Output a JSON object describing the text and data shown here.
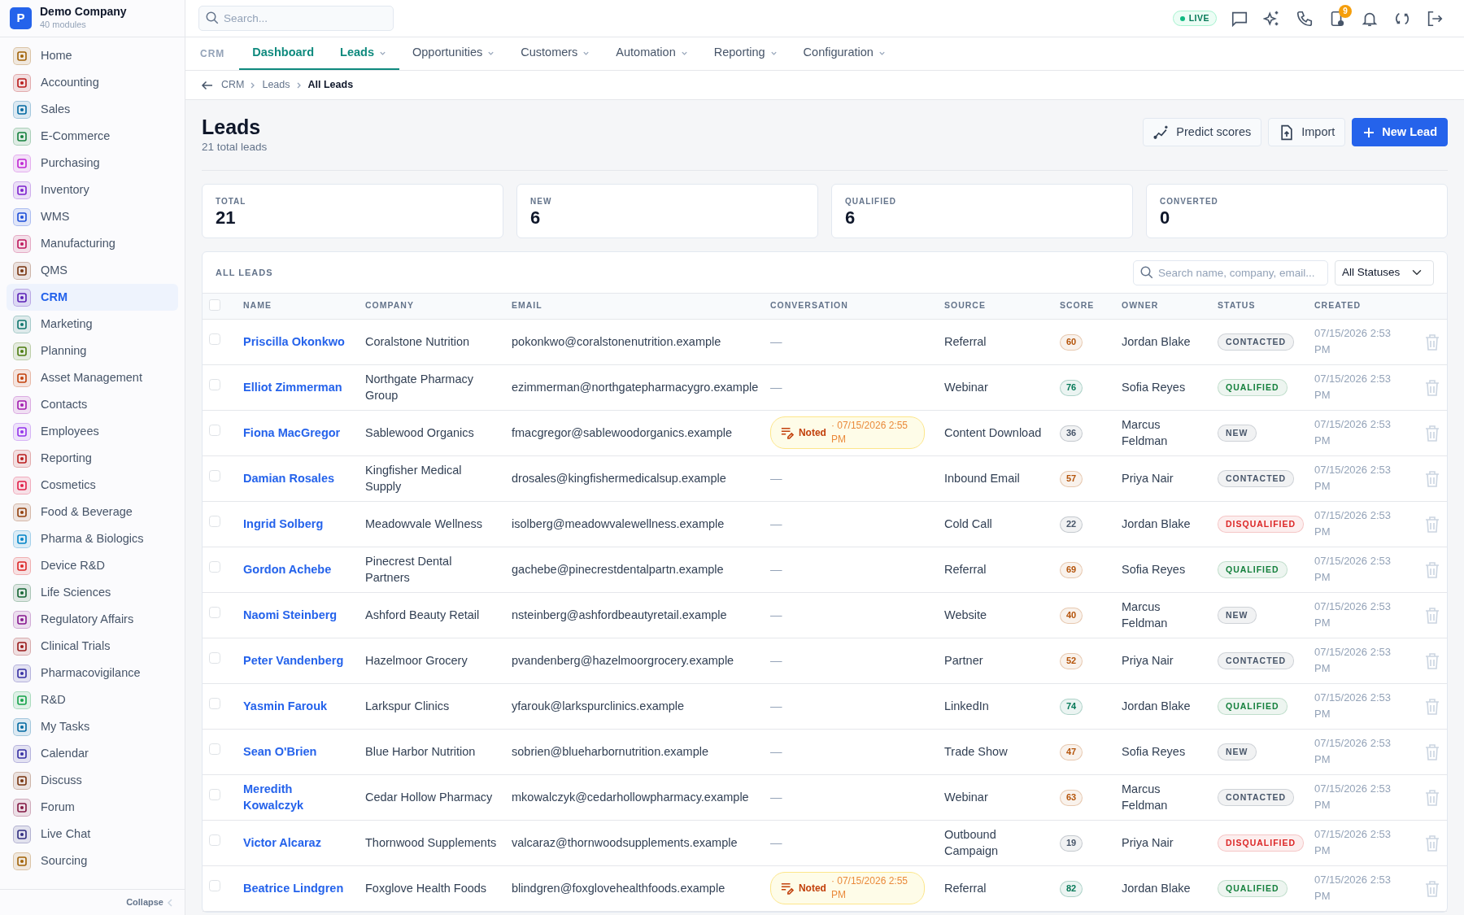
{
  "company": {
    "logo": "P",
    "name": "Demo Company",
    "subtitle": "40 modules"
  },
  "sidebar": {
    "items": [
      {
        "label": "Home",
        "color": "#a16207",
        "selected": false
      },
      {
        "label": "Accounting",
        "color": "#b91c1c",
        "selected": false
      },
      {
        "label": "Sales",
        "color": "#0369a1",
        "selected": false
      },
      {
        "label": "E-Commerce",
        "color": "#15803d",
        "selected": false
      },
      {
        "label": "Purchasing",
        "color": "#c026d3",
        "selected": false
      },
      {
        "label": "Inventory",
        "color": "#7e22ce",
        "selected": false
      },
      {
        "label": "WMS",
        "color": "#1d4ed8",
        "selected": false
      },
      {
        "label": "Manufacturing",
        "color": "#be185d",
        "selected": false
      },
      {
        "label": "QMS",
        "color": "#78350f",
        "selected": false
      },
      {
        "label": "CRM",
        "color": "#5b21b6",
        "selected": true
      },
      {
        "label": "Marketing",
        "color": "#0f766e",
        "selected": false
      },
      {
        "label": "Planning",
        "color": "#4d7c0f",
        "selected": false
      },
      {
        "label": "Asset Management",
        "color": "#c2410c",
        "selected": false
      },
      {
        "label": "Contacts",
        "color": "#a21caf",
        "selected": false
      },
      {
        "label": "Employees",
        "color": "#9333ea",
        "selected": false
      },
      {
        "label": "Reporting",
        "color": "#b91c1c",
        "selected": false
      },
      {
        "label": "Cosmetics",
        "color": "#e11d48",
        "selected": false
      },
      {
        "label": "Food & Beverage",
        "color": "#92400e",
        "selected": false
      },
      {
        "label": "Pharma & Biologics",
        "color": "#0284c7",
        "selected": false
      },
      {
        "label": "Device R&D",
        "color": "#dc2626",
        "selected": false
      },
      {
        "label": "Life Sciences",
        "color": "#166534",
        "selected": false
      },
      {
        "label": "Regulatory Affairs",
        "color": "#86198f",
        "selected": false
      },
      {
        "label": "Clinical Trials",
        "color": "#991b1b",
        "selected": false
      },
      {
        "label": "Pharmacovigilance",
        "color": "#3730a3",
        "selected": false
      },
      {
        "label": "R&D",
        "color": "#16a34a",
        "selected": false
      },
      {
        "label": "My Tasks",
        "color": "#0369a1",
        "selected": false
      },
      {
        "label": "Calendar",
        "color": "#3730a3",
        "selected": false
      },
      {
        "label": "Discuss",
        "color": "#78350f",
        "selected": false
      },
      {
        "label": "Forum",
        "color": "#831843",
        "selected": false
      },
      {
        "label": "Live Chat",
        "color": "#312e81",
        "selected": false
      },
      {
        "label": "Sourcing",
        "color": "#a16207",
        "selected": false
      }
    ],
    "collapse": "Collapse"
  },
  "topbar": {
    "search": {
      "placeholder": "Search..."
    },
    "live": "LIVE",
    "notification_count": "9"
  },
  "nav": {
    "section": "CRM",
    "tabs": [
      {
        "label": "Dashboard",
        "selected": true,
        "dropdown": false
      },
      {
        "label": "Leads",
        "selected": true,
        "dropdown": true
      },
      {
        "label": "Opportunities",
        "selected": false,
        "dropdown": true
      },
      {
        "label": "Customers",
        "selected": false,
        "dropdown": true
      },
      {
        "label": "Automation",
        "selected": false,
        "dropdown": true
      },
      {
        "label": "Reporting",
        "selected": false,
        "dropdown": true
      },
      {
        "label": "Configuration",
        "selected": false,
        "dropdown": true
      }
    ]
  },
  "breadcrumb": [
    "CRM",
    "Leads",
    "All Leads"
  ],
  "header": {
    "title": "Leads",
    "subtitle": "21 total leads",
    "buttons": [
      {
        "label": "Predict scores",
        "kind": "predict"
      },
      {
        "label": "Import",
        "kind": "import"
      },
      {
        "label": "New Lead",
        "kind": "new"
      }
    ]
  },
  "stats": [
    {
      "label": "TOTAL",
      "value": "21"
    },
    {
      "label": "NEW",
      "value": "6"
    },
    {
      "label": "QUALIFIED",
      "value": "6"
    },
    {
      "label": "CONVERTED",
      "value": "0"
    }
  ],
  "table": {
    "title": "ALL LEADS",
    "search": {
      "placeholder": "Search name, company, email..."
    },
    "status_filter": "All Statuses",
    "select_all_checked": false,
    "columns": [
      "NAME",
      "COMPANY",
      "EMAIL",
      "CONVERSATION",
      "SOURCE",
      "SCORE",
      "OWNER",
      "STATUS",
      "CREATED"
    ],
    "rows": [
      {
        "checked": false,
        "name": "Priscilla Okonkwo",
        "company": "Coralstone Nutrition",
        "email": "pokonkwo@coralstonenutrition.example",
        "conversation": {
          "kind": "empty",
          "text": "—"
        },
        "source": "Referral",
        "score": {
          "text": "60",
          "color": "#b45309"
        },
        "owner": "Jordan Blake",
        "status": {
          "text": "CONTACTED",
          "color": "#475569"
        },
        "created": "07/15/2026 2:53 PM"
      },
      {
        "checked": false,
        "name": "Elliot Zimmerman",
        "company": "Northgate Pharmacy Group",
        "email": "ezimmerman@northgatepharmacygro.example",
        "conversation": {
          "kind": "empty",
          "text": "—"
        },
        "source": "Webinar",
        "score": {
          "text": "76",
          "color": "#047857"
        },
        "owner": "Sofia Reyes",
        "status": {
          "text": "QUALIFIED",
          "color": "#15803d"
        },
        "created": "07/15/2026 2:53 PM"
      },
      {
        "checked": false,
        "name": "Fiona MacGregor",
        "company": "Sablewood Organics",
        "email": "fmacgregor@sablewoodorganics.example",
        "conversation": {
          "kind": "note",
          "label": "Noted",
          "time": "· 07/15/2026 2:55 PM"
        },
        "source": "Content Download",
        "score": {
          "text": "36",
          "color": "#475569"
        },
        "owner": "Marcus Feldman",
        "status": {
          "text": "NEW",
          "color": "#475569"
        },
        "created": "07/15/2026 2:53 PM"
      },
      {
        "checked": false,
        "name": "Damian Rosales",
        "company": "Kingfisher Medical Supply",
        "email": "drosales@kingfishermedicalsup.example",
        "conversation": {
          "kind": "empty",
          "text": "—"
        },
        "source": "Inbound Email",
        "score": {
          "text": "57",
          "color": "#b45309"
        },
        "owner": "Priya Nair",
        "status": {
          "text": "CONTACTED",
          "color": "#475569"
        },
        "created": "07/15/2026 2:53 PM"
      },
      {
        "checked": false,
        "name": "Ingrid Solberg",
        "company": "Meadowvale Wellness",
        "email": "isolberg@meadowvalewellness.example",
        "conversation": {
          "kind": "empty",
          "text": "—"
        },
        "source": "Cold Call",
        "score": {
          "text": "22",
          "color": "#475569"
        },
        "owner": "Jordan Blake",
        "status": {
          "text": "DISQUALIFIED",
          "color": "#dc2626"
        },
        "created": "07/15/2026 2:53 PM"
      },
      {
        "checked": false,
        "name": "Gordon Achebe",
        "company": "Pinecrest Dental Partners",
        "email": "gachebe@pinecrestdentalpartn.example",
        "conversation": {
          "kind": "empty",
          "text": "—"
        },
        "source": "Referral",
        "score": {
          "text": "69",
          "color": "#b45309"
        },
        "owner": "Sofia Reyes",
        "status": {
          "text": "QUALIFIED",
          "color": "#15803d"
        },
        "created": "07/15/2026 2:53 PM"
      },
      {
        "checked": false,
        "name": "Naomi Steinberg",
        "company": "Ashford Beauty Retail",
        "email": "nsteinberg@ashfordbeautyretail.example",
        "conversation": {
          "kind": "empty",
          "text": "—"
        },
        "source": "Website",
        "score": {
          "text": "40",
          "color": "#b45309"
        },
        "owner": "Marcus Feldman",
        "status": {
          "text": "NEW",
          "color": "#475569"
        },
        "created": "07/15/2026 2:53 PM"
      },
      {
        "checked": false,
        "name": "Peter Vandenberg",
        "company": "Hazelmoor Grocery",
        "email": "pvandenberg@hazelmoorgrocery.example",
        "conversation": {
          "kind": "empty",
          "text": "—"
        },
        "source": "Partner",
        "score": {
          "text": "52",
          "color": "#b45309"
        },
        "owner": "Priya Nair",
        "status": {
          "text": "CONTACTED",
          "color": "#475569"
        },
        "created": "07/15/2026 2:53 PM"
      },
      {
        "checked": false,
        "name": "Yasmin Farouk",
        "company": "Larkspur Clinics",
        "email": "yfarouk@larkspurclinics.example",
        "conversation": {
          "kind": "empty",
          "text": "—"
        },
        "source": "LinkedIn",
        "score": {
          "text": "74",
          "color": "#047857"
        },
        "owner": "Jordan Blake",
        "status": {
          "text": "QUALIFIED",
          "color": "#15803d"
        },
        "created": "07/15/2026 2:53 PM"
      },
      {
        "checked": false,
        "name": "Sean O'Brien",
        "company": "Blue Harbor Nutrition",
        "email": "sobrien@blueharbornutrition.example",
        "conversation": {
          "kind": "empty",
          "text": "—"
        },
        "source": "Trade Show",
        "score": {
          "text": "47",
          "color": "#b45309"
        },
        "owner": "Sofia Reyes",
        "status": {
          "text": "NEW",
          "color": "#475569"
        },
        "created": "07/15/2026 2:53 PM"
      },
      {
        "checked": false,
        "name": "Meredith Kowalczyk",
        "company": "Cedar Hollow Pharmacy",
        "email": "mkowalczyk@cedarhollowpharmacy.example",
        "conversation": {
          "kind": "empty",
          "text": "—"
        },
        "source": "Webinar",
        "score": {
          "text": "63",
          "color": "#b45309"
        },
        "owner": "Marcus Feldman",
        "status": {
          "text": "CONTACTED",
          "color": "#475569"
        },
        "created": "07/15/2026 2:53 PM"
      },
      {
        "checked": false,
        "name": "Victor Alcaraz",
        "company": "Thornwood Supplements",
        "email": "valcaraz@thornwoodsupplements.example",
        "conversation": {
          "kind": "empty",
          "text": "—"
        },
        "source": "Outbound Campaign",
        "score": {
          "text": "19",
          "color": "#475569"
        },
        "owner": "Priya Nair",
        "status": {
          "text": "DISQUALIFIED",
          "color": "#dc2626"
        },
        "created": "07/15/2026 2:53 PM"
      },
      {
        "checked": false,
        "name": "Beatrice Lindgren",
        "company": "Foxglove Health Foods",
        "email": "blindgren@foxglovehealthfoods.example",
        "conversation": {
          "kind": "note",
          "label": "Noted",
          "time": "· 07/15/2026 2:55 PM"
        },
        "source": "Referral",
        "score": {
          "text": "82",
          "color": "#047857"
        },
        "owner": "Jordan Blake",
        "status": {
          "text": "QUALIFIED",
          "color": "#15803d"
        },
        "created": "07/15/2026 2:53 PM"
      }
    ]
  }
}
